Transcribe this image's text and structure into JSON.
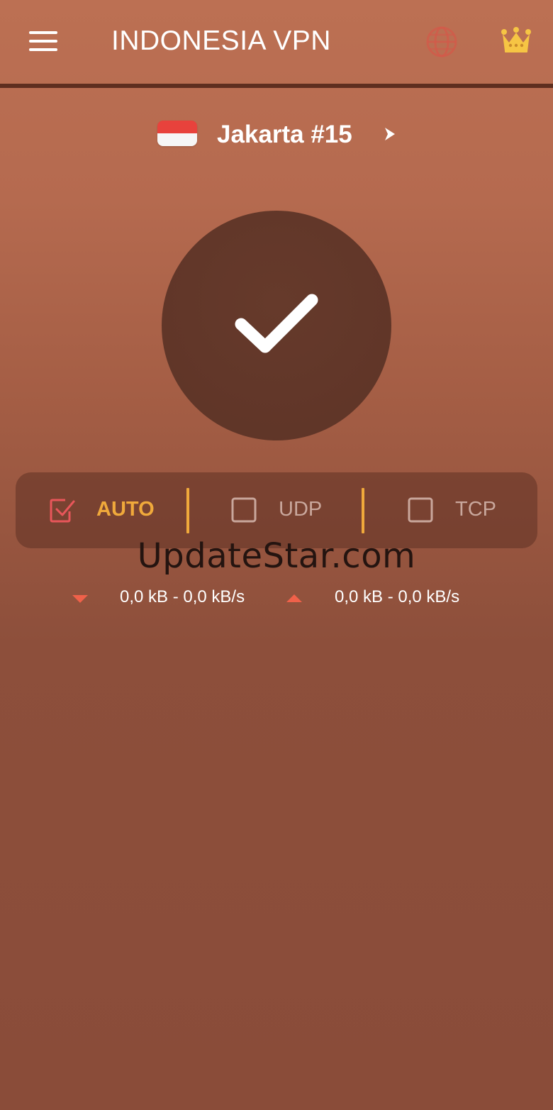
{
  "header": {
    "title": "INDONESIA VPN",
    "menu_icon": "hamburger-menu-icon",
    "globe_icon": "globe-icon",
    "premium_icon": "crown-icon"
  },
  "server": {
    "flag": "indonesia-flag",
    "name": "Jakarta #15",
    "chevron": "chevron-right-icon"
  },
  "connect": {
    "state": "connected",
    "icon": "check-icon"
  },
  "protocols": [
    {
      "label": "AUTO",
      "selected": true
    },
    {
      "label": "UDP",
      "selected": false
    },
    {
      "label": "TCP",
      "selected": false
    }
  ],
  "watermark": "UpdateStar.com",
  "traffic": {
    "download": "0,0 kB - 0,0 kB/s",
    "upload": "0,0 kB - 0,0 kB/s"
  },
  "colors": {
    "accent": "#f0a93b",
    "selected_checkbox": "#e8565a",
    "unselected": "#c9a79c",
    "arrow": "#f0614a",
    "crown": "#f6c544"
  }
}
